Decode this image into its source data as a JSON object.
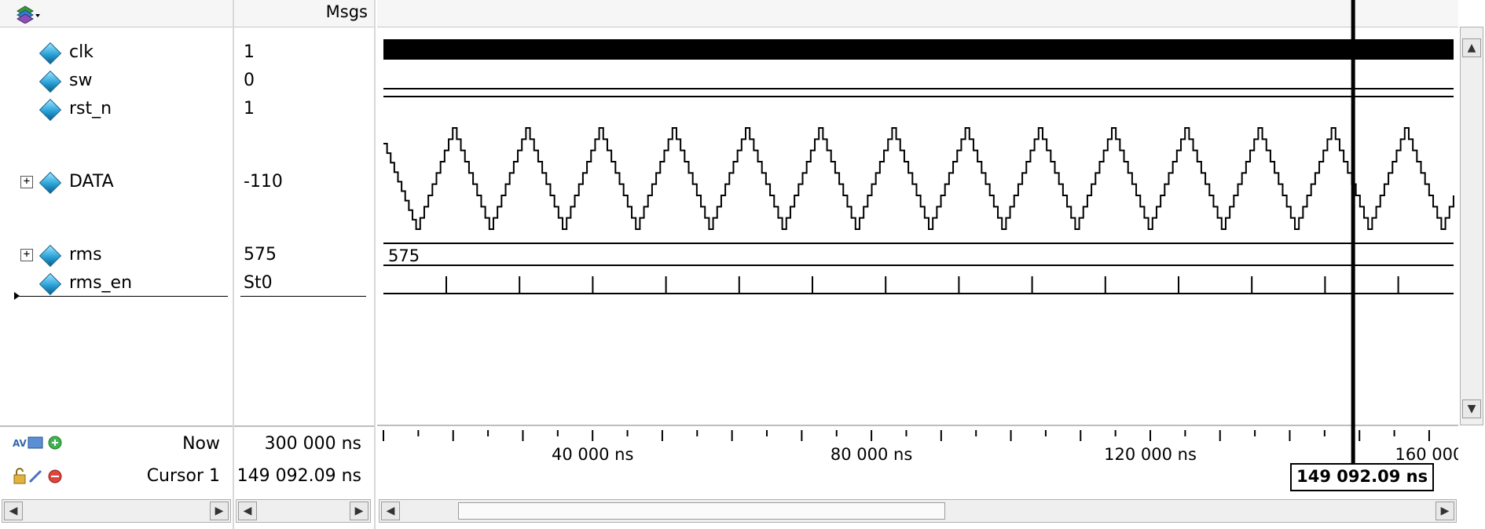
{
  "header": {
    "toolbar_icon": "layers-dropdown-icon",
    "msgs_label": "Msgs"
  },
  "signals": [
    {
      "name": "clk",
      "value": "1",
      "expandable": false
    },
    {
      "name": "sw",
      "value": "0",
      "expandable": false
    },
    {
      "name": "rst_n",
      "value": "1",
      "expandable": false
    },
    {
      "name": "DATA",
      "value": "-110",
      "expandable": true
    },
    {
      "name": "rms",
      "value": "575",
      "expandable": true
    },
    {
      "name": "rms_en",
      "value": "St0",
      "expandable": false
    }
  ],
  "wave_labels": {
    "rms_bus_value": "575"
  },
  "footer": {
    "now_label": "Now",
    "now_value": "300 000 ns",
    "cursor_label": "Cursor 1",
    "cursor_value": "149 092.09 ns",
    "cursor_readout": "149 092.09 ns"
  },
  "timeline": {
    "tick_labels": [
      "40 000 ns",
      "80 000 ns",
      "120 000 ns",
      "160 000"
    ],
    "tick_values_ns": [
      40000,
      80000,
      120000,
      160000
    ],
    "view_start_ns": 10000,
    "view_end_ns": 163500,
    "cursor_ns": 149092.09
  },
  "colors": {
    "wave": "#000000",
    "signal_icon": "#2aa3d8",
    "cursor": "#000000"
  }
}
